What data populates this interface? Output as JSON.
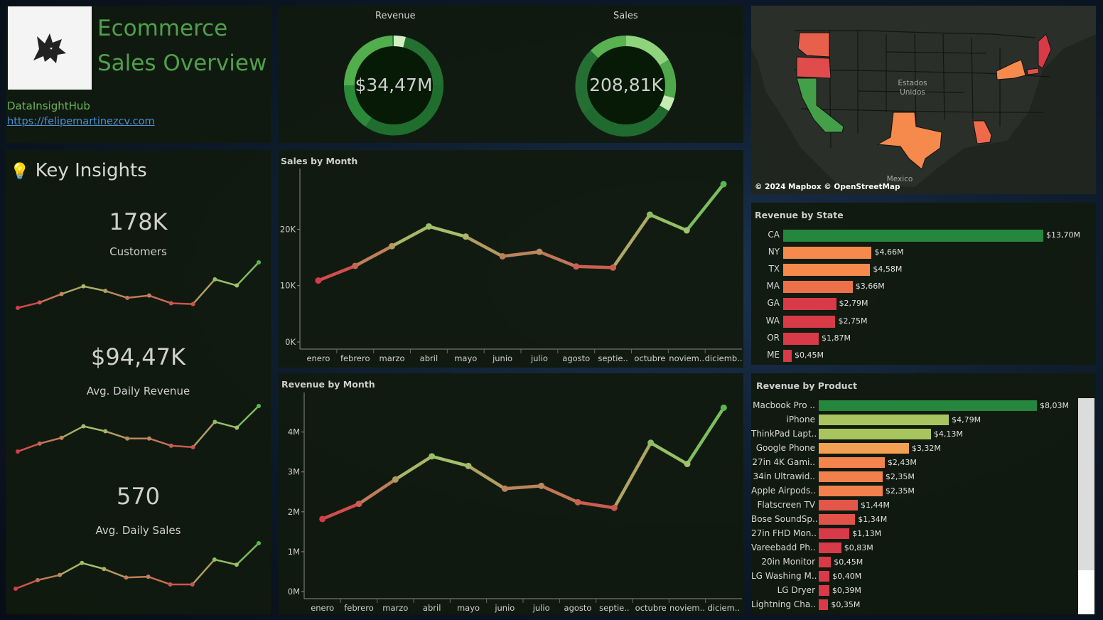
{
  "header": {
    "title_line1": "Ecommerce",
    "title_line2": "Sales Overview",
    "brand": "DataInsightHub",
    "link": "https://felipemartinezcv.com",
    "logo_icon": "wolf-head-logo"
  },
  "kpis": {
    "revenue_label": "Revenue",
    "revenue_value": "$34,47M",
    "sales_label": "Sales",
    "sales_value": "208,81K"
  },
  "map": {
    "label_country": "Estados",
    "label_country2": "Unidos",
    "label_mexico": "Mexico",
    "attribution": "© 2024 Mapbox  © OpenStreetMap"
  },
  "insights": {
    "icon": "lightbulb-icon",
    "title": "Key Insights",
    "customers_value": "178K",
    "customers_label": "Customers",
    "revenue_value": "$94,47K",
    "revenue_label": "Avg. Daily Revenue",
    "sales_value": "570",
    "sales_label": "Avg. Daily Sales"
  },
  "colors": {
    "high": "#58b84e",
    "mid": "#a4c16b",
    "low": "#d83a48",
    "orange": "#f58a4c",
    "accent_title": "#4fa04a",
    "top_bar": "#24873d"
  },
  "chart_data": [
    {
      "id": "sales_by_month",
      "type": "line",
      "title": "Sales by Month",
      "categories": [
        "enero",
        "febrero",
        "marzo",
        "abril",
        "mayo",
        "junio",
        "julio",
        "agosto",
        "septie..",
        "octubre",
        "noviem..",
        "diciemb.."
      ],
      "values": [
        10900,
        13500,
        17000,
        20500,
        18700,
        15200,
        16000,
        13400,
        13200,
        22600,
        19800,
        28000
      ],
      "yticks": [
        "0K",
        "10K",
        "20K"
      ],
      "ytick_values": [
        0,
        10000,
        20000
      ],
      "ylim": [
        0,
        28000
      ]
    },
    {
      "id": "revenue_by_month",
      "type": "line",
      "title": "Revenue by Month",
      "categories": [
        "enero",
        "febrero",
        "marzo",
        "abril",
        "mayo",
        "junio",
        "julio",
        "agosto",
        "septie..",
        "octubre",
        "noviem..",
        "diciem.."
      ],
      "values": [
        1.82,
        2.2,
        2.81,
        3.39,
        3.15,
        2.58,
        2.65,
        2.24,
        2.1,
        3.73,
        3.2,
        4.61
      ],
      "yticks": [
        "0M",
        "1M",
        "2M",
        "3M",
        "4M"
      ],
      "ytick_values": [
        0,
        1,
        2,
        3,
        4
      ],
      "ylim": [
        0,
        4.6
      ]
    },
    {
      "id": "revenue_by_state",
      "type": "bar",
      "title": "Revenue by State",
      "categories": [
        "CA",
        "NY",
        "TX",
        "MA",
        "GA",
        "WA",
        "OR",
        "ME"
      ],
      "values": [
        13.7,
        4.66,
        4.58,
        3.66,
        2.79,
        2.75,
        1.87,
        0.45
      ],
      "labels": [
        "$13,70M",
        "$4,66M",
        "$4,58M",
        "$3,66M",
        "$2,79M",
        "$2,75M",
        "$1,87M",
        "$0,45M"
      ]
    },
    {
      "id": "revenue_by_product",
      "type": "bar",
      "title": "Revenue by Product",
      "categories": [
        "Macbook Pro ..",
        "iPhone",
        "ThinkPad Lapt..",
        "Google Phone",
        "27in 4K Gami..",
        "34in Ultrawid..",
        "Apple Airpods..",
        "Flatscreen TV",
        "Bose SoundSp..",
        "27in FHD Mon..",
        "Vareebadd Ph..",
        "20in Monitor",
        "LG Washing M..",
        "LG Dryer",
        "Lightning Cha.."
      ],
      "values": [
        8.03,
        4.79,
        4.13,
        3.32,
        2.43,
        2.35,
        2.35,
        1.44,
        1.34,
        1.13,
        0.83,
        0.45,
        0.4,
        0.39,
        0.35
      ],
      "labels": [
        "$8,03M",
        "$4,79M",
        "$4,13M",
        "$3,32M",
        "$2,43M",
        "$2,35M",
        "$2,35M",
        "$1,44M",
        "$1,34M",
        "$1,13M",
        "$0,83M",
        "$0,45M",
        "$0,40M",
        "$0,39M",
        "$0,35M"
      ]
    },
    {
      "id": "customers_spark",
      "type": "line",
      "values": [
        0.3,
        1.0,
        2.1,
        3.1,
        2.5,
        1.6,
        1.9,
        0.9,
        0.8,
        4.0,
        3.2,
        6.2
      ]
    },
    {
      "id": "daily_revenue_spark",
      "type": "line",
      "values": [
        0.3,
        1.4,
        2.2,
        3.8,
        3.1,
        2.1,
        2.1,
        1.1,
        0.9,
        4.4,
        3.6,
        6.6
      ]
    },
    {
      "id": "daily_sales_spark",
      "type": "line",
      "values": [
        0.3,
        1.3,
        1.9,
        3.3,
        2.6,
        1.6,
        1.7,
        0.8,
        0.8,
        3.7,
        3.1,
        5.6
      ]
    }
  ]
}
